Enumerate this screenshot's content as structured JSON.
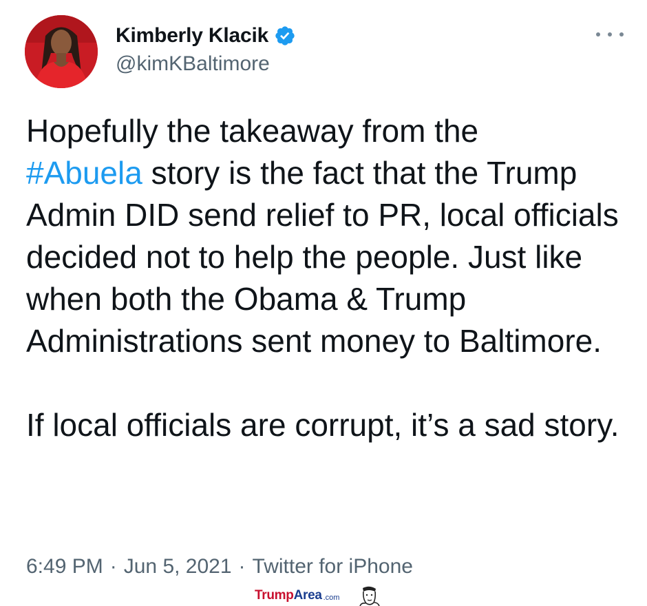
{
  "user": {
    "display_name": "Kimberly Klacik",
    "handle": "@kimKBaltimore",
    "verified": true,
    "avatar": "profile-photo"
  },
  "tweet": {
    "hashtag": "#Abuela",
    "line_before_hashtag": "Hopefully the takeaway from the",
    "text_after_hashtag": " story is the fact that the Trump Admin DID send relief to PR, local officials decided not to help the people. Just like when both the Obama & Trump Administrations sent money to Baltimore.",
    "second_paragraph": "If local officials are corrupt, it’s a sad story."
  },
  "meta": {
    "time": "6:49 PM",
    "separator": "·",
    "date": "Jun 5, 2021",
    "source": "Twitter for iPhone"
  },
  "watermark": {
    "brand_part1": "Trump",
    "brand_part2": "Area",
    "brand_suffix": ".com"
  },
  "icons": {
    "more": "more-options-icon",
    "verified": "verified-badge-icon"
  },
  "colors": {
    "link": "#1d9bf0",
    "secondary_text": "#536471",
    "verified_badge": "#1d9bf0",
    "watermark_red": "#c8102e",
    "watermark_blue": "#1a3d8f"
  }
}
